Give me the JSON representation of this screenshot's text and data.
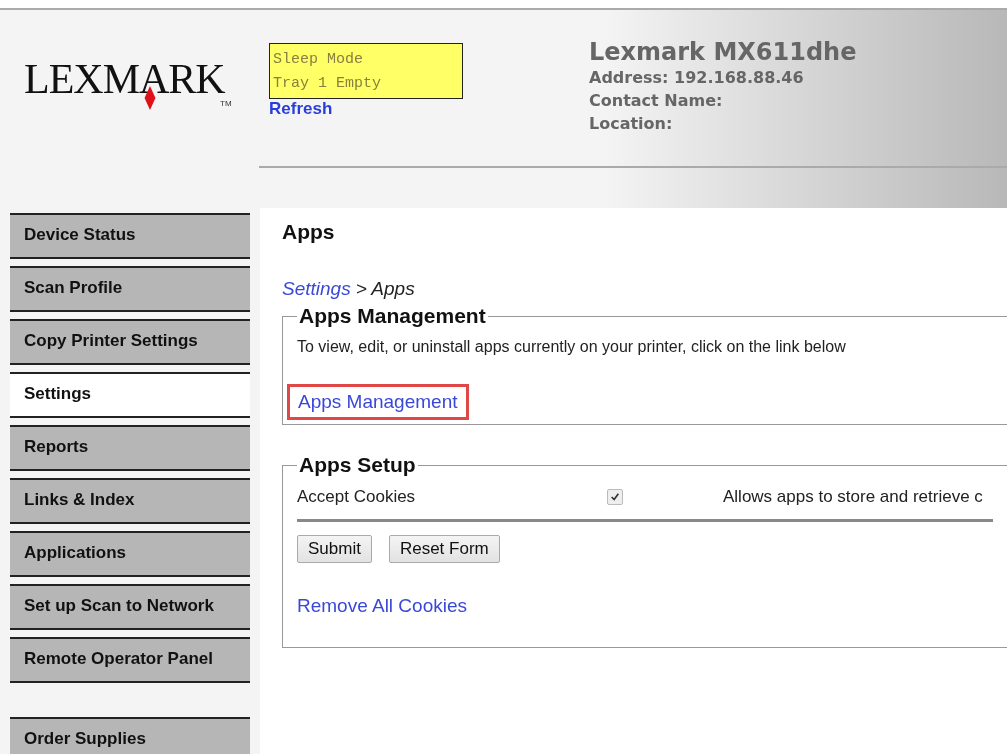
{
  "logo": {
    "text": "LEXMARK",
    "tm": "TM"
  },
  "status_panel": {
    "lines": [
      "Sleep Mode",
      "Tray 1 Empty"
    ],
    "refresh": "Refresh"
  },
  "device": {
    "model": "Lexmark MX611dhe",
    "lines": [
      "Address: 192.168.88.46",
      "Contact Name:",
      "Location:"
    ]
  },
  "sidebar": {
    "items": [
      {
        "label": "Device Status",
        "selected": false
      },
      {
        "label": "Scan Profile",
        "selected": false
      },
      {
        "label": "Copy Printer Settings",
        "selected": false
      },
      {
        "label": "Settings",
        "selected": true
      },
      {
        "label": "Reports",
        "selected": false
      },
      {
        "label": "Links & Index",
        "selected": false
      },
      {
        "label": "Applications",
        "selected": false
      },
      {
        "label": "Set up Scan to Network",
        "selected": false
      },
      {
        "label": "Remote Operator Panel",
        "selected": false
      }
    ],
    "extra_items": [
      {
        "label": "Order Supplies",
        "selected": false
      }
    ]
  },
  "page": {
    "title": "Apps",
    "breadcrumb": {
      "link": "Settings",
      "separator": ">",
      "current": "Apps"
    }
  },
  "apps_management": {
    "legend": "Apps Management",
    "text": "To view, edit, or uninstall apps currently on your printer, click on the link below",
    "link": "Apps Management",
    "highlighted": true
  },
  "apps_setup": {
    "legend": "Apps Setup",
    "setting": {
      "label": "Accept Cookies",
      "checked": true,
      "description": "Allows apps to store and retrieve c"
    },
    "buttons": [
      "Submit",
      "Reset Form"
    ],
    "link": "Remove All Cookies"
  }
}
